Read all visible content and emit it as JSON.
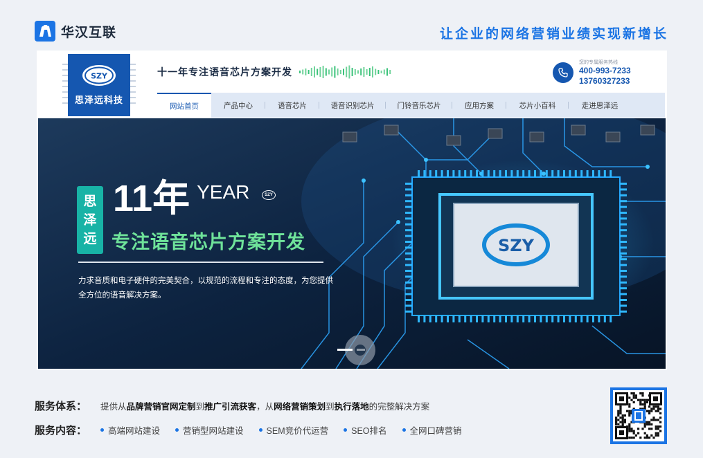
{
  "brand": {
    "name": "华汉互联",
    "slogan": "让企业的网络营销业绩实现新增长"
  },
  "site": {
    "logo_badge": "SZY",
    "logo_text": "思泽远科技",
    "header_slogan": "十一年专注语音芯片方案开发",
    "contact_label": "您的专属服务热线",
    "phone1": "400-993-7233",
    "phone2": "13760327233",
    "nav": [
      {
        "label": "网站首页",
        "active": true
      },
      {
        "label": "产品中心"
      },
      {
        "label": "语音芯片"
      },
      {
        "label": "语音识别芯片"
      },
      {
        "label": "门铃音乐芯片"
      },
      {
        "label": "应用方案"
      },
      {
        "label": "芯片小百科"
      },
      {
        "label": "走进思泽远"
      }
    ]
  },
  "hero": {
    "tag": [
      "思",
      "泽",
      "远"
    ],
    "number": "11年",
    "year_word": "YEAR",
    "mini_logo": "SZY",
    "chip_logo": "SZY",
    "subtitle": "专注语音芯片方案开发",
    "description": "力求音质和电子硬件的完美契合，以规范的流程和专注的态度，为您提供全方位的语音解决方案。"
  },
  "services": {
    "system_title": "服务体系：",
    "system_parts": [
      "提供从",
      "品牌营销官网定制",
      "到",
      "推广引流获客",
      "，从",
      "网络营销策划",
      "到",
      "执行落地",
      "的完整解决方案"
    ],
    "content_title": "服务内容：",
    "content_items": [
      "高端网站建设",
      "营销型网站建设",
      "SEM竞价代运营",
      "SEO排名",
      "全网口碑营销"
    ]
  },
  "colors": {
    "accent": "#1b74e4",
    "navy": "#1557b0",
    "teal": "#18b3a6",
    "green": "#6fe39a"
  }
}
